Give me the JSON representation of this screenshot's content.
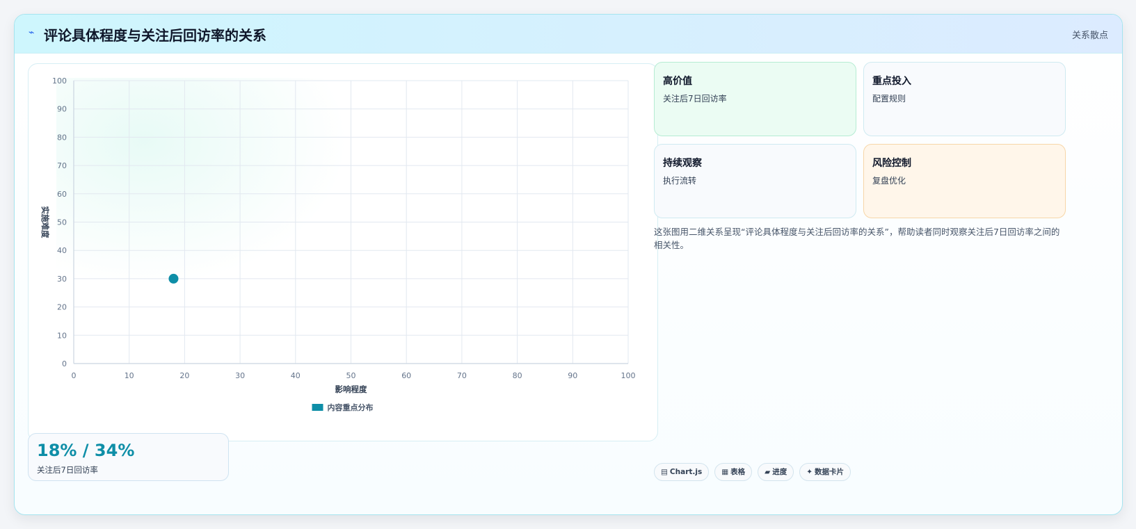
{
  "header": {
    "icon": "⌁",
    "title": "评论具体程度与关注后回访率的关系",
    "badge": "关系散点"
  },
  "cards": [
    {
      "title": "高价值",
      "subtitle": "关注后7日回访率",
      "tone": "green"
    },
    {
      "title": "重点投入",
      "subtitle": "配置规则",
      "tone": "neutral"
    },
    {
      "title": "持续观察",
      "subtitle": "执行流转",
      "tone": "neutral"
    },
    {
      "title": "风险控制",
      "subtitle": "复盘优化",
      "tone": "orange"
    }
  ],
  "description": "这张图用二维关系呈现“评论具体程度与关注后回访率的关系”，帮助读者同时观察关注后7日回访率之间的相关性。",
  "kpi": {
    "value": "18% / 34%",
    "label": "关注后7日回访率"
  },
  "tags": [
    {
      "icon": "▤",
      "icon_name": "chart-icon",
      "label": "Chart.js"
    },
    {
      "icon": "▦",
      "icon_name": "table-icon",
      "label": "表格"
    },
    {
      "icon": "▰",
      "icon_name": "progress-icon",
      "label": "进度"
    },
    {
      "icon": "✦",
      "icon_name": "sparkle-icon",
      "label": "数据卡片"
    }
  ],
  "colors": {
    "accent": "#0e8ea7",
    "point": "#0e8ea7"
  },
  "chart_data": {
    "type": "scatter",
    "xlabel": "影响程度",
    "ylabel": "实施难度",
    "xlim": [
      0,
      100
    ],
    "ylim": [
      0,
      100
    ],
    "xticks": [
      0,
      10,
      20,
      30,
      40,
      50,
      60,
      70,
      80,
      90,
      100
    ],
    "yticks": [
      0,
      10,
      20,
      30,
      40,
      50,
      60,
      70,
      80,
      90,
      100
    ],
    "grid": true,
    "legend_position": "bottom",
    "series": [
      {
        "name": "内容重点分布",
        "color": "#0e8ea7",
        "points": [
          {
            "x": 18,
            "y": 30
          }
        ]
      }
    ]
  }
}
